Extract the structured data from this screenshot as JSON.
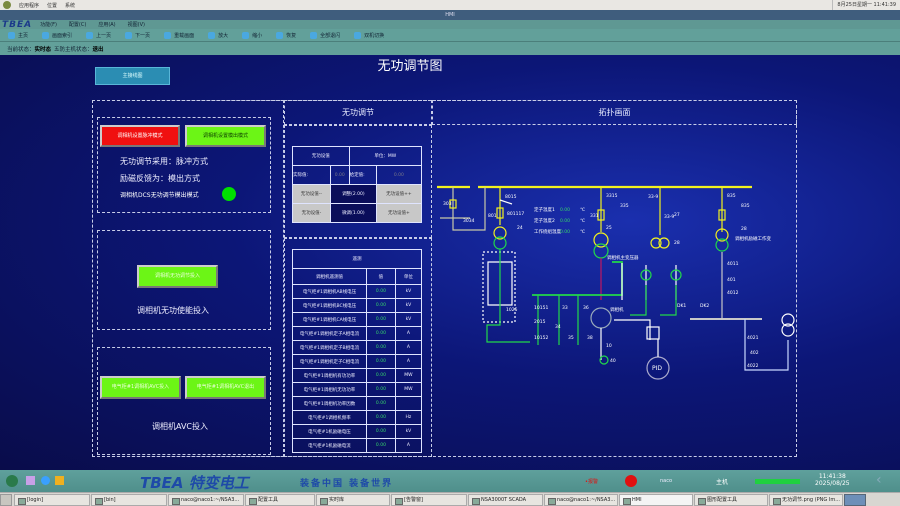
{
  "system_bar": {
    "menus": [
      "应用程序",
      "位置",
      "系统"
    ],
    "clock": "8月25日星期一 11:41:39"
  },
  "window": {
    "title": "HMI"
  },
  "menu": {
    "logo": "TBEA",
    "items": [
      "功能(F)",
      "配置(C)",
      "应用(A)",
      "视图(V)"
    ]
  },
  "toolbar": {
    "items": [
      {
        "label": "主页",
        "icon": "home-icon"
      },
      {
        "label": "画面索引",
        "icon": "index-icon"
      },
      {
        "label": "上一页",
        "icon": "prev-icon"
      },
      {
        "label": "下一页",
        "icon": "next-icon"
      },
      {
        "label": "重载画面",
        "icon": "reload-icon"
      },
      {
        "label": "放大",
        "icon": "zoom-in-icon"
      },
      {
        "label": "缩小",
        "icon": "zoom-out-icon"
      },
      {
        "label": "恢复",
        "icon": "restore-icon"
      },
      {
        "label": "全部退闪",
        "icon": "stop-flash-icon"
      },
      {
        "label": "双机切换",
        "icon": "switch-icon"
      }
    ]
  },
  "status": {
    "state_label": "当前状态：",
    "state_value": "实时态",
    "host_label": "五防主机状态：",
    "host_value": "退出"
  },
  "page": {
    "title": "无功调节图",
    "main_wiring_button": "主接线图"
  },
  "sections": {
    "reactive": "无功调节",
    "topology": "拓扑画面"
  },
  "left": {
    "pulse_button": "调相机设置脉冲模式",
    "analog_button": "调相机设置模出模式",
    "mode_text": "无功调节采用：脉冲方式",
    "feedback_text": "励磁反馈为：模出方式",
    "dcs_text": "调相机DCS无功调节模出模式",
    "dcs_indicator_color": "#00e000",
    "enable_button": "调相机无功调节投入",
    "enable_text": "调相机无功使能投入",
    "avc_on_button": "电气柜#1调相机AVC投入",
    "avc_off_button": "电气柜#1调相机AVC退出",
    "avc_text": "调相机AVC投入"
  },
  "setpoint": {
    "title": "无功设值",
    "unit": "单位：MW",
    "actual_label": "实际值:",
    "actual_value": "0.00",
    "set_label": "给定值:",
    "set_value": "0.00",
    "minus_minus": "无功设值--",
    "adjust_big": "调整(2.00)",
    "plus_plus": "无功设值++",
    "minus": "无功设值-",
    "adjust_small": "微调(1.00)",
    "plus": "无功设值+"
  },
  "telemetry": {
    "title": "遥测",
    "headers": [
      "调相机遥测值",
      "值",
      "单位"
    ],
    "rows": [
      [
        "电气柜#1调相机AB线电压",
        "0.00",
        "kV"
      ],
      [
        "电气柜#1调相机BC线电压",
        "0.00",
        "kV"
      ],
      [
        "电气柜#1调相机CA线电压",
        "0.00",
        "kV"
      ],
      [
        "电气柜#1调相机定子A相电流",
        "0.00",
        "A"
      ],
      [
        "电气柜#1调相机定子B相电流",
        "0.00",
        "A"
      ],
      [
        "电气柜#1调相机定子C相电流",
        "0.00",
        "A"
      ],
      [
        "电气柜#1调相机有功功率",
        "0.00",
        "MW"
      ],
      [
        "电气柜#1调相机无功功率",
        "0.00",
        "MW"
      ],
      [
        "电气柜#1调相机功率因数",
        "0.00",
        ""
      ],
      [
        "电气柜#1调相机频率",
        "0.00",
        "Hz"
      ],
      [
        "电气柜#1机励磁电压",
        "0.00",
        "kV"
      ],
      [
        "电气柜#1机励磁电流",
        "0.00",
        "A"
      ]
    ]
  },
  "topology": {
    "labels": [
      "303",
      "3034",
      "8015",
      "801",
      "801117",
      "24",
      "3315",
      "331",
      "335",
      "25",
      "33-9",
      "33-9",
      "27",
      "28",
      "835",
      "835",
      "28",
      "调相机励磁工作变",
      "4011",
      "401",
      "4012",
      "调相机主变压器",
      "1025",
      "10151",
      "33",
      "36",
      "2015",
      "34",
      "35",
      "38",
      "10152",
      "调相机",
      "10",
      "40",
      "DK1",
      "DK2",
      "4021",
      "402",
      "4022",
      "PID"
    ],
    "temps": [
      {
        "label": "定子温度1",
        "value": "0.00",
        "unit": "℃"
      },
      {
        "label": "定子温度2",
        "value": "0.00",
        "unit": "℃"
      },
      {
        "label": "工作绕组温度",
        "value": "0.00",
        "unit": "℃"
      }
    ],
    "colors": {
      "bus": "#f2f21e",
      "feeder_green": "#22d84a",
      "line_gray": "#c8c8c8"
    }
  },
  "banner": {
    "logo": "TBEA 特变电工",
    "slogan": "装备中国 装备世界",
    "alarm_label": "•报警",
    "alarm_color": "#e01010",
    "node": "naco",
    "host_label": "主机",
    "time": "11:41:38",
    "date": "2025/08/25"
  },
  "taskbar": {
    "items": [
      "[login]",
      "[bin]",
      "naco@naco1:~/NSA3...",
      "配置工具",
      "实时库",
      "[告警窗]",
      "NSA3000T SCADA",
      "naco@naco1:~/NSA3...",
      "HMI",
      "图形配置工具",
      "无功调节.png (PNG Im..."
    ]
  }
}
